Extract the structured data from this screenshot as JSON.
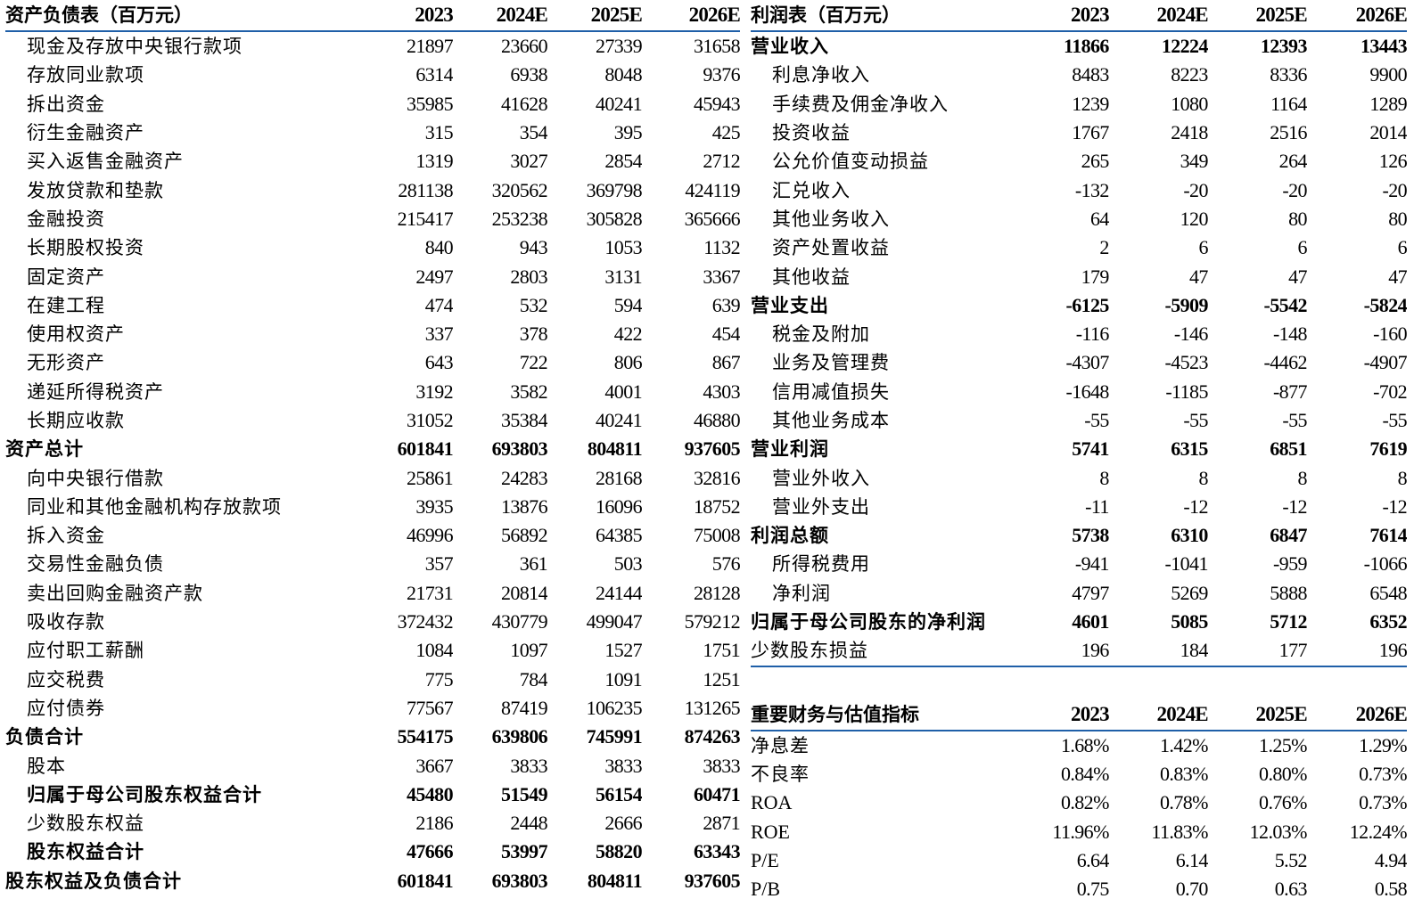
{
  "balance": {
    "title": "资产负债表（百万元）",
    "years": [
      "2023",
      "2024E",
      "2025E",
      "2026E"
    ],
    "rows": [
      {
        "label": "现金及存放中央银行款项",
        "values": [
          "21897",
          "23660",
          "27339",
          "31658"
        ],
        "bold": false
      },
      {
        "label": "存放同业款项",
        "values": [
          "6314",
          "6938",
          "8048",
          "9376"
        ],
        "bold": false
      },
      {
        "label": "拆出资金",
        "values": [
          "35985",
          "41628",
          "40241",
          "45943"
        ],
        "bold": false
      },
      {
        "label": "衍生金融资产",
        "values": [
          "315",
          "354",
          "395",
          "425"
        ],
        "bold": false
      },
      {
        "label": "买入返售金融资产",
        "values": [
          "1319",
          "3027",
          "2854",
          "2712"
        ],
        "bold": false
      },
      {
        "label": "发放贷款和垫款",
        "values": [
          "281138",
          "320562",
          "369798",
          "424119"
        ],
        "bold": false
      },
      {
        "label": "金融投资",
        "values": [
          "215417",
          "253238",
          "305828",
          "365666"
        ],
        "bold": false
      },
      {
        "label": "长期股权投资",
        "values": [
          "840",
          "943",
          "1053",
          "1132"
        ],
        "bold": false
      },
      {
        "label": "固定资产",
        "values": [
          "2497",
          "2803",
          "3131",
          "3367"
        ],
        "bold": false
      },
      {
        "label": "在建工程",
        "values": [
          "474",
          "532",
          "594",
          "639"
        ],
        "bold": false
      },
      {
        "label": "使用权资产",
        "values": [
          "337",
          "378",
          "422",
          "454"
        ],
        "bold": false
      },
      {
        "label": "无形资产",
        "values": [
          "643",
          "722",
          "806",
          "867"
        ],
        "bold": false
      },
      {
        "label": "递延所得税资产",
        "values": [
          "3192",
          "3582",
          "4001",
          "4303"
        ],
        "bold": false
      },
      {
        "label": "长期应收款",
        "values": [
          "31052",
          "35384",
          "40241",
          "46880"
        ],
        "bold": false
      },
      {
        "label": "资产总计",
        "values": [
          "601841",
          "693803",
          "804811",
          "937605"
        ],
        "bold": true,
        "top": true
      },
      {
        "label": "向中央银行借款",
        "values": [
          "25861",
          "24283",
          "28168",
          "32816"
        ],
        "bold": false
      },
      {
        "label": "同业和其他金融机构存放款项",
        "values": [
          "3935",
          "13876",
          "16096",
          "18752"
        ],
        "bold": false
      },
      {
        "label": "拆入资金",
        "values": [
          "46996",
          "56892",
          "64385",
          "75008"
        ],
        "bold": false
      },
      {
        "label": "交易性金融负债",
        "values": [
          "357",
          "361",
          "503",
          "576"
        ],
        "bold": false
      },
      {
        "label": "卖出回购金融资产款",
        "values": [
          "21731",
          "20814",
          "24144",
          "28128"
        ],
        "bold": false
      },
      {
        "label": "吸收存款",
        "values": [
          "372432",
          "430779",
          "499047",
          "579212"
        ],
        "bold": false
      },
      {
        "label": "应付职工薪酬",
        "values": [
          "1084",
          "1097",
          "1527",
          "1751"
        ],
        "bold": false
      },
      {
        "label": "应交税费",
        "values": [
          "775",
          "784",
          "1091",
          "1251"
        ],
        "bold": false
      },
      {
        "label": "应付债券",
        "values": [
          "77567",
          "87419",
          "106235",
          "131265"
        ],
        "bold": false
      },
      {
        "label": "负债合计",
        "values": [
          "554175",
          "639806",
          "745991",
          "874263"
        ],
        "bold": true,
        "top": true
      },
      {
        "label": "股本",
        "values": [
          "3667",
          "3833",
          "3833",
          "3833"
        ],
        "bold": false
      },
      {
        "label": "归属于母公司股东权益合计",
        "values": [
          "45480",
          "51549",
          "56154",
          "60471"
        ],
        "bold": true
      },
      {
        "label": "少数股东权益",
        "values": [
          "2186",
          "2448",
          "2666",
          "2871"
        ],
        "bold": false
      },
      {
        "label": "股东权益合计",
        "values": [
          "47666",
          "53997",
          "58820",
          "63343"
        ],
        "bold": true
      },
      {
        "label": "股东权益及负债合计",
        "values": [
          "601841",
          "693803",
          "804811",
          "937605"
        ],
        "bold": true,
        "top": true
      }
    ]
  },
  "income": {
    "title": "利润表（百万元）",
    "years": [
      "2023",
      "2024E",
      "2025E",
      "2026E"
    ],
    "rows": [
      {
        "label": "营业收入",
        "values": [
          "11866",
          "12224",
          "12393",
          "13443"
        ],
        "bold": true,
        "top": true
      },
      {
        "label": "利息净收入",
        "values": [
          "8483",
          "8223",
          "8336",
          "9900"
        ],
        "bold": false
      },
      {
        "label": "手续费及佣金净收入",
        "values": [
          "1239",
          "1080",
          "1164",
          "1289"
        ],
        "bold": false
      },
      {
        "label": "投资收益",
        "values": [
          "1767",
          "2418",
          "2516",
          "2014"
        ],
        "bold": false
      },
      {
        "label": "公允价值变动损益",
        "values": [
          "265",
          "349",
          "264",
          "126"
        ],
        "bold": false
      },
      {
        "label": "汇兑收入",
        "values": [
          "-132",
          "-20",
          "-20",
          "-20"
        ],
        "bold": false
      },
      {
        "label": "其他业务收入",
        "values": [
          "64",
          "120",
          "80",
          "80"
        ],
        "bold": false
      },
      {
        "label": "资产处置收益",
        "values": [
          "2",
          "6",
          "6",
          "6"
        ],
        "bold": false
      },
      {
        "label": "其他收益",
        "values": [
          "179",
          "47",
          "47",
          "47"
        ],
        "bold": false
      },
      {
        "label": "营业支出",
        "values": [
          "-6125",
          "-5909",
          "-5542",
          "-5824"
        ],
        "bold": true,
        "top": true
      },
      {
        "label": "税金及附加",
        "values": [
          "-116",
          "-146",
          "-148",
          "-160"
        ],
        "bold": false
      },
      {
        "label": "业务及管理费",
        "values": [
          "-4307",
          "-4523",
          "-4462",
          "-4907"
        ],
        "bold": false
      },
      {
        "label": "信用减值损失",
        "values": [
          "-1648",
          "-1185",
          "-877",
          "-702"
        ],
        "bold": false
      },
      {
        "label": "其他业务成本",
        "values": [
          "-55",
          "-55",
          "-55",
          "-55"
        ],
        "bold": false
      },
      {
        "label": "营业利润",
        "values": [
          "5741",
          "6315",
          "6851",
          "7619"
        ],
        "bold": true,
        "top": true
      },
      {
        "label": "营业外收入",
        "values": [
          "8",
          "8",
          "8",
          "8"
        ],
        "bold": false
      },
      {
        "label": "营业外支出",
        "values": [
          "-11",
          "-12",
          "-12",
          "-12"
        ],
        "bold": false
      },
      {
        "label": "利润总额",
        "values": [
          "5738",
          "6310",
          "6847",
          "7614"
        ],
        "bold": true,
        "top": true
      },
      {
        "label": "所得税费用",
        "values": [
          "-941",
          "-1041",
          "-959",
          "-1066"
        ],
        "bold": false
      },
      {
        "label": "净利润",
        "values": [
          "4797",
          "5269",
          "5888",
          "6548"
        ],
        "bold": false
      },
      {
        "label": "归属于母公司股东的净利润",
        "values": [
          "4601",
          "5085",
          "5712",
          "6352"
        ],
        "bold": true,
        "top": true
      },
      {
        "label": "少数股东损益",
        "values": [
          "196",
          "184",
          "177",
          "196"
        ],
        "bold": false,
        "top": true
      }
    ]
  },
  "metrics": {
    "title": "重要财务与估值指标",
    "years": [
      "2023",
      "2024E",
      "2025E",
      "2026E"
    ],
    "rows": [
      {
        "label": "净息差",
        "values": [
          "1.68%",
          "1.42%",
          "1.25%",
          "1.29%"
        ]
      },
      {
        "label": "不良率",
        "values": [
          "0.84%",
          "0.83%",
          "0.80%",
          "0.73%"
        ]
      },
      {
        "label": "ROA",
        "values": [
          "0.82%",
          "0.78%",
          "0.76%",
          "0.73%"
        ],
        "latin": true
      },
      {
        "label": "ROE",
        "values": [
          "11.96%",
          "11.83%",
          "12.03%",
          "12.24%"
        ],
        "latin": true
      },
      {
        "label": "P/E",
        "values": [
          "6.64",
          "6.14",
          "5.52",
          "4.94"
        ],
        "latin": true
      },
      {
        "label": "P/B",
        "values": [
          "0.75",
          "0.70",
          "0.63",
          "0.58"
        ],
        "latin": true
      }
    ]
  }
}
